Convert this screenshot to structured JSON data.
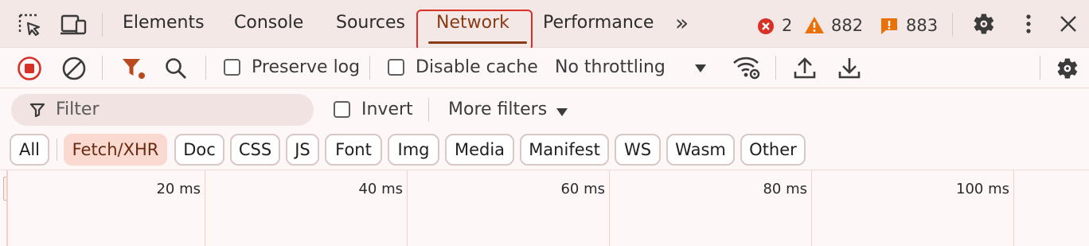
{
  "tabs": {
    "elements": "Elements",
    "console": "Console",
    "sources": "Sources",
    "network": "Network",
    "performance": "Performance",
    "more": "»"
  },
  "badges": {
    "errors": "2",
    "warnings": "882",
    "issues": "883"
  },
  "toolbar": {
    "preserve_log": "Preserve log",
    "disable_cache": "Disable cache",
    "throttling": "No throttling"
  },
  "filter": {
    "placeholder": "Filter",
    "invert": "Invert",
    "more_filters": "More filters"
  },
  "type_filters": [
    "All",
    "Fetch/XHR",
    "Doc",
    "CSS",
    "JS",
    "Font",
    "Img",
    "Media",
    "Manifest",
    "WS",
    "Wasm",
    "Other"
  ],
  "active_type_filter": "Fetch/XHR",
  "timeline": {
    "ticks": [
      "20 ms",
      "40 ms",
      "60 ms",
      "80 ms",
      "100 ms"
    ]
  },
  "colors": {
    "error": "#d93025",
    "warning": "#e8710a",
    "issue": "#e8710a",
    "record": "#d93025",
    "accent": "#8a3b14",
    "highlight_box": "#d93025"
  }
}
